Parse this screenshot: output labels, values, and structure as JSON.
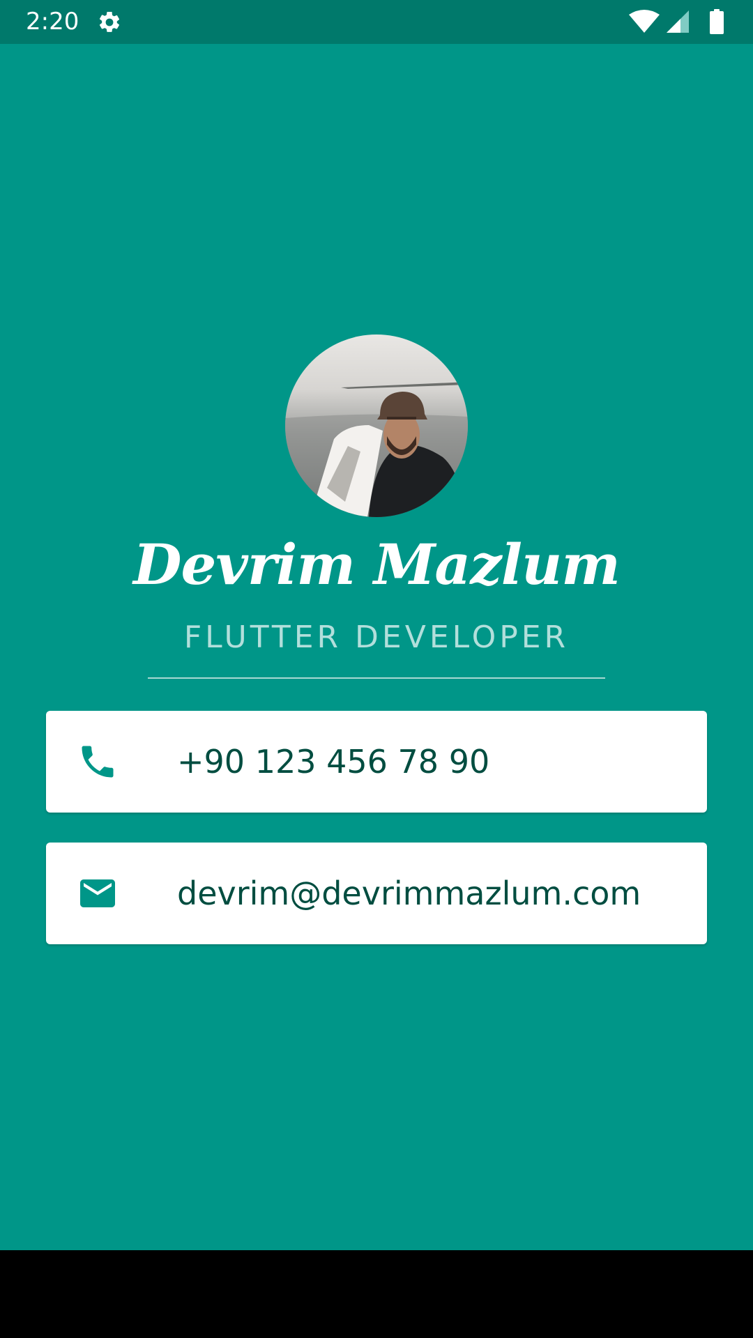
{
  "status_bar": {
    "time": "2:20",
    "icons": [
      "gear-icon",
      "wifi-icon",
      "cell-signal-icon",
      "battery-icon"
    ]
  },
  "profile": {
    "name": "Devrim Mazlum",
    "title": "FLUTTER DEVELOPER",
    "avatar": "profile-photo"
  },
  "contacts": {
    "phone": {
      "icon": "phone-icon",
      "text": "+90 123 456 78 90"
    },
    "email": {
      "icon": "mail-icon",
      "text": "devrim@devrimmazlum.com"
    }
  },
  "colors": {
    "background": "#009688",
    "status_bar": "#00796b",
    "title_text": "#b2dfdb",
    "card_text": "#004d40",
    "icon": "#009688",
    "card": "#ffffff"
  }
}
